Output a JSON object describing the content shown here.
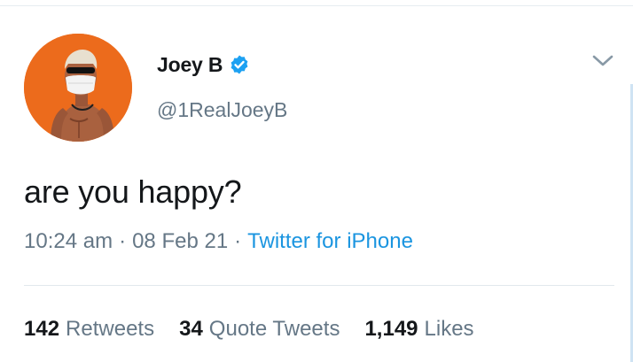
{
  "tweet": {
    "author": {
      "display_name": "Joey B",
      "handle": "@1RealJoeyB",
      "verified": true,
      "avatar_bg": "#ec6b1c"
    },
    "text": "are you happy?",
    "time": "10:24 am",
    "date": "08 Feb 21",
    "source": "Twitter for iPhone",
    "separator": "·",
    "stats": {
      "retweets_count": "142",
      "retweets_label": "Retweets",
      "quotes_count": "34",
      "quotes_label": "Quote Tweets",
      "likes_count": "1,149",
      "likes_label": "Likes"
    }
  },
  "icons": {
    "verified": "verified-badge-icon",
    "caret": "chevron-down-icon"
  },
  "colors": {
    "primary_text": "#14171a",
    "secondary_text": "#657786",
    "link": "#1b95e0",
    "verified": "#1da1f2",
    "divider": "#e1e8ed"
  }
}
